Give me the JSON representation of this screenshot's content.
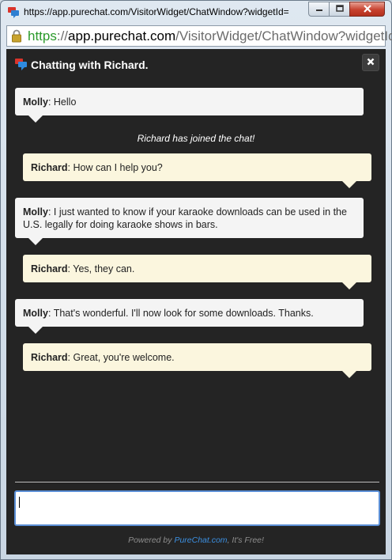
{
  "window": {
    "title": "https://app.purechat.com/VisitorWidget/ChatWindow?widgetId="
  },
  "address_bar": {
    "scheme": "https",
    "separator": "://",
    "host": "app.purechat.com",
    "path": "/VisitorWidget/ChatWindow?widgetId="
  },
  "chat": {
    "title": "Chatting with Richard.",
    "system_message": "Richard has joined the chat!",
    "messages": [
      {
        "sender": "Molly",
        "role": "visitor",
        "text": "Hello"
      },
      {
        "sender": "Richard",
        "role": "operator",
        "text": "How can I help you?"
      },
      {
        "sender": "Molly",
        "role": "visitor",
        "text": "I just wanted to know if your karaoke downloads can be used in the U.S. legally for doing karaoke shows in bars."
      },
      {
        "sender": "Richard",
        "role": "operator",
        "text": "Yes, they can."
      },
      {
        "sender": "Molly",
        "role": "visitor",
        "text": "That's wonderful. I'll now look for some downloads. Thanks."
      },
      {
        "sender": "Richard",
        "role": "operator",
        "text": "Great, you're welcome."
      }
    ],
    "input_value": ""
  },
  "footer": {
    "prefix": "Powered by",
    "link": "PureChat.com",
    "suffix": ", It's Free!"
  },
  "colors": {
    "chat_background": "#242424",
    "visitor_bubble": "#f4f4f4",
    "operator_bubble": "#fbf6de",
    "link": "#3c8fe0",
    "https_green": "#2a9a2a"
  }
}
